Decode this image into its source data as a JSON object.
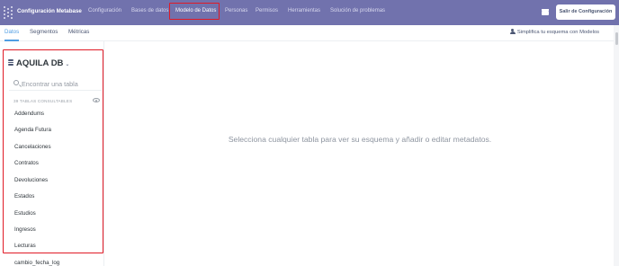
{
  "app": {
    "brand": "Configuración Metabase",
    "exit_button": "Salir de Configuración"
  },
  "nav": {
    "items": [
      {
        "label": "Configuración"
      },
      {
        "label": "Bases de datos"
      },
      {
        "label": "Modelo de Datos",
        "active": true
      },
      {
        "label": "Personas"
      },
      {
        "label": "Permisos"
      },
      {
        "label": "Herramientas"
      },
      {
        "label": "Solución de problemas"
      }
    ]
  },
  "tabs": {
    "items": [
      {
        "label": "Datos",
        "active": true
      },
      {
        "label": "Segmentos"
      },
      {
        "label": "Métricas"
      }
    ],
    "simplify_link": "Simplifica tu esquema con Modelos"
  },
  "sidebar": {
    "database_name": "AQUILA DB",
    "search_placeholder": "Encontrar una tabla",
    "table_count_label": "39 TABLAS CONSULTABLES",
    "tables": [
      "Addendums",
      "Agenda Futura",
      "Cancelaciones",
      "Contratos",
      "Devoluciones",
      "Estados",
      "Estudios",
      "Ingresos",
      "Lecturas",
      "cambio_fecha_log"
    ]
  },
  "main": {
    "message": "Selecciona cualquier tabla para ver su esquema y añadir o editar metadatos."
  },
  "colors": {
    "topbar": "#7172ad",
    "accent": "#509ee3",
    "highlight_border": "#e01a26"
  }
}
